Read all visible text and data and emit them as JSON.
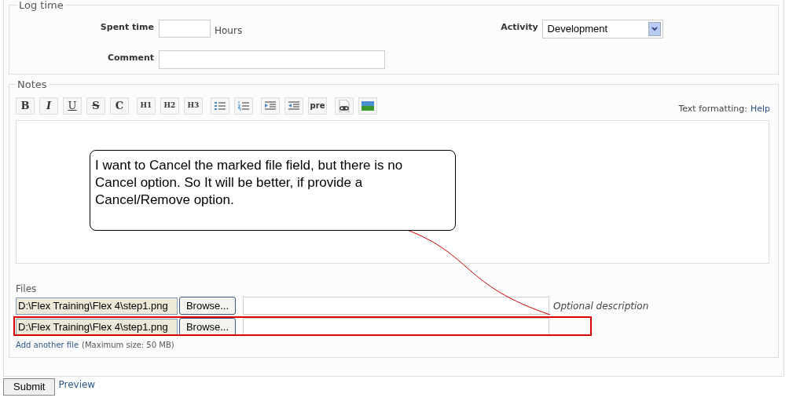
{
  "log_time": {
    "legend": "Log time",
    "spent_time": {
      "label": "Spent time",
      "unit": "Hours"
    },
    "comment": {
      "label": "Comment"
    },
    "activity": {
      "label": "Activity",
      "value": "Development"
    }
  },
  "notes": {
    "legend": "Notes",
    "toolbar": [
      {
        "kind": "text",
        "label": "B"
      },
      {
        "kind": "text",
        "label": "I"
      },
      {
        "kind": "text",
        "label": "U"
      },
      {
        "kind": "text",
        "label": "S"
      },
      {
        "kind": "text",
        "label": "C"
      },
      {
        "kind": "text",
        "label": "H1"
      },
      {
        "kind": "text",
        "label": "H2"
      },
      {
        "kind": "text",
        "label": "H3"
      },
      {
        "kind": "bullets"
      },
      {
        "kind": "numbers"
      },
      {
        "kind": "indent"
      },
      {
        "kind": "outdent"
      },
      {
        "kind": "text",
        "label": "pre"
      },
      {
        "kind": "link"
      },
      {
        "kind": "image"
      }
    ],
    "formatting_label": "Text formatting:",
    "formatting_link": "Help"
  },
  "files": {
    "label": "Files",
    "rows": [
      {
        "path": "D:\\Flex Training\\Flex 4\\step1.png",
        "browse": "Browse...",
        "hint": "Optional description",
        "marked": false
      },
      {
        "path": "D:\\Flex Training\\Flex 4\\step1.png",
        "browse": "Browse...",
        "marked": true
      }
    ],
    "add_link": "Add another file",
    "max_size": "(Maximum size: 50 MB)"
  },
  "callout": "I want to Cancel the marked file field, but there is no Cancel option. So It will be better, if provide a Cancel/Remove option.",
  "submit": "Submit",
  "preview": "Preview"
}
